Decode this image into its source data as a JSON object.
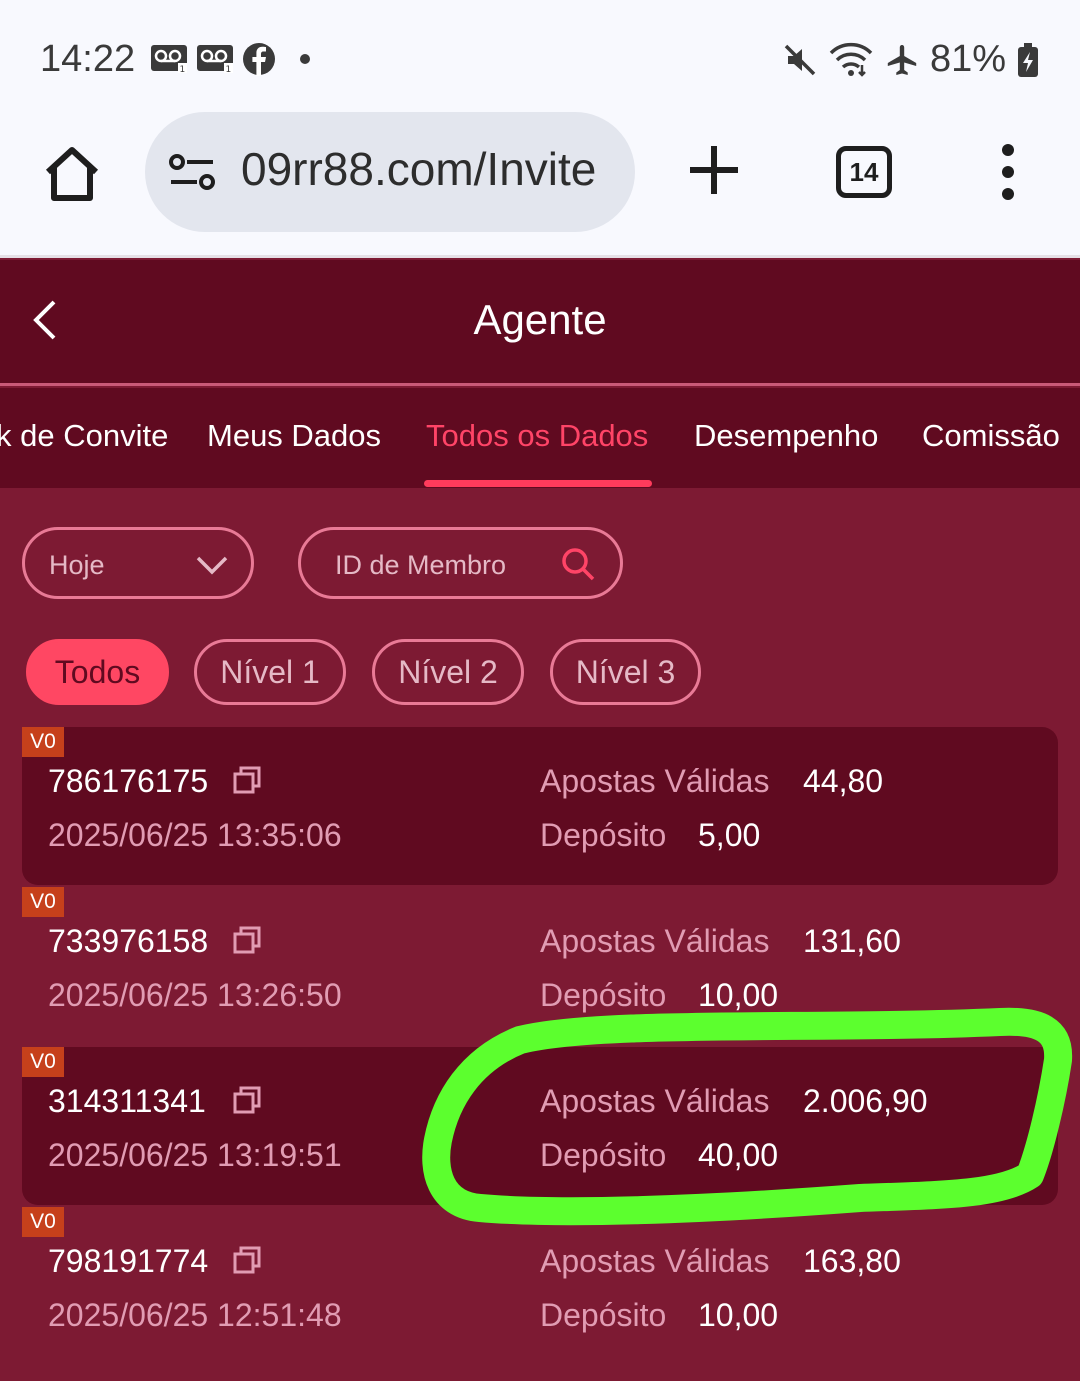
{
  "status_bar": {
    "time": "14:22",
    "battery": "81%",
    "icons_left": [
      "voicemail-icon",
      "voicemail-icon",
      "facebook-icon",
      "dot"
    ],
    "icons_right": [
      "mute-icon",
      "wifi-icon",
      "airplane-icon",
      "battery-charging-icon"
    ]
  },
  "browser": {
    "url": "09rr88.com/Invite",
    "tab_count": "14"
  },
  "header": {
    "title": "Agente"
  },
  "tabs": [
    {
      "label": "k de Convite"
    },
    {
      "label": "Meus Dados"
    },
    {
      "label": "Todos os Dados",
      "active": true
    },
    {
      "label": "Desempenho"
    },
    {
      "label": "Comissão"
    }
  ],
  "filters": {
    "period": "Hoje",
    "member_placeholder": "ID de Membro"
  },
  "levels": [
    {
      "label": "Todos",
      "active": true
    },
    {
      "label": "Nível 1"
    },
    {
      "label": "Nível 2"
    },
    {
      "label": "Nível 3"
    }
  ],
  "labels": {
    "valid_bets": "Apostas Válidas",
    "deposit": "Depósito"
  },
  "records": [
    {
      "vip": "V0",
      "id": "786176175",
      "datetime": "2025/06/25 13:35:06",
      "valid_bets": "44,80",
      "deposit": "5,00"
    },
    {
      "vip": "V0",
      "id": "733976158",
      "datetime": "2025/06/25 13:26:50",
      "valid_bets": "131,60",
      "deposit": "10,00"
    },
    {
      "vip": "V0",
      "id": "314311341",
      "datetime": "2025/06/25 13:19:51",
      "valid_bets": "2.006,90",
      "deposit": "40,00"
    },
    {
      "vip": "V0",
      "id": "798191774",
      "datetime": "2025/06/25 12:51:48",
      "valid_bets": "163,80",
      "deposit": "10,00"
    }
  ],
  "colors": {
    "header_bg": "#600a20",
    "page_bg": "#7d1a33",
    "accent": "#ff3b5c",
    "badge": "#c6401b",
    "annotation": "#5cff2e"
  }
}
